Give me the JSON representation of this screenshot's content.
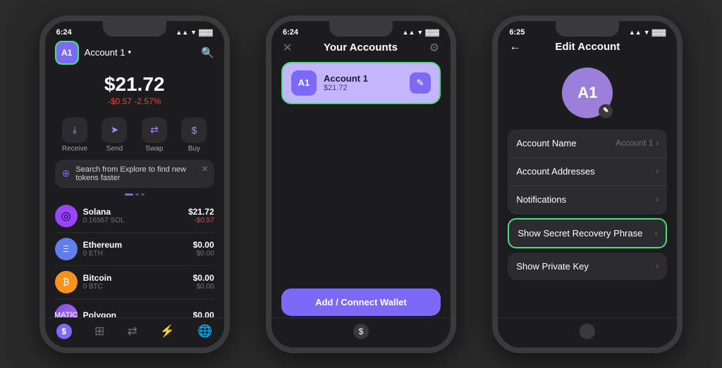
{
  "scene": {
    "background": "#2a2a2a"
  },
  "phone1": {
    "status_time": "6:24",
    "account_badge": "A1",
    "account_name": "Account 1",
    "balance": "$21.72",
    "balance_change": "-$0.57  -2.57%",
    "actions": [
      "Receive",
      "Send",
      "Swap",
      "Buy"
    ],
    "search_banner_text": "Search from Explore to find new tokens faster",
    "tokens": [
      {
        "name": "Solana",
        "sub": "0.16567 SOL",
        "usd": "$21.72",
        "change": "-$0.57",
        "icon": "◎",
        "color": "#9945ff"
      },
      {
        "name": "Ethereum",
        "sub": "0 ETH",
        "usd": "$0.00",
        "change": "$0.00",
        "icon": "Ξ",
        "color": "#627eea"
      },
      {
        "name": "Bitcoin",
        "sub": "0 BTC",
        "usd": "$0.00",
        "change": "$0.00",
        "icon": "₿",
        "color": "#f7931a"
      },
      {
        "name": "Polygon",
        "sub": "",
        "usd": "$0.00",
        "change": "",
        "icon": "⬡",
        "color": "#8247e5"
      }
    ]
  },
  "phone2": {
    "status_time": "6:24",
    "title": "Your Accounts",
    "account_name": "Account 1",
    "account_balance": "$21.72",
    "account_badge": "A1",
    "add_button_label": "Add / Connect Wallet"
  },
  "phone3": {
    "status_time": "6:25",
    "title": "Edit Account",
    "account_badge": "A1",
    "settings": [
      {
        "label": "Account Name",
        "value": "Account 1 >",
        "highlighted": false
      },
      {
        "label": "Account Addresses",
        "value": "",
        "highlighted": false
      },
      {
        "label": "Notifications",
        "value": "",
        "highlighted": false
      },
      {
        "label": "Show Secret Recovery Phrase",
        "value": "",
        "highlighted": true
      },
      {
        "label": "Show Private Key",
        "value": "",
        "highlighted": false
      }
    ]
  }
}
